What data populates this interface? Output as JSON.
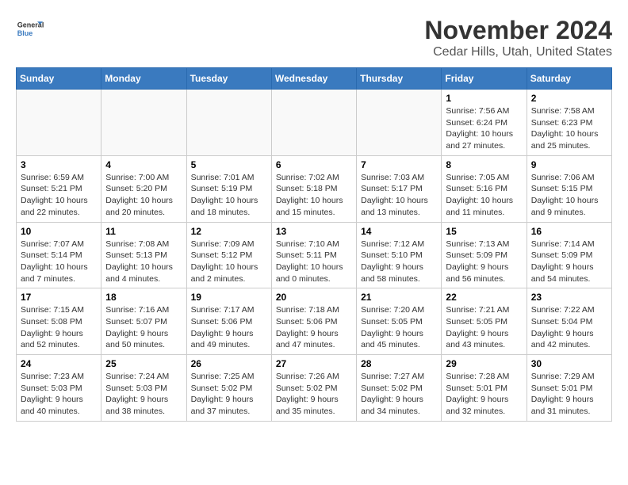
{
  "header": {
    "logo_line1": "General",
    "logo_line2": "Blue",
    "month": "November 2024",
    "location": "Cedar Hills, Utah, United States"
  },
  "weekdays": [
    "Sunday",
    "Monday",
    "Tuesday",
    "Wednesday",
    "Thursday",
    "Friday",
    "Saturday"
  ],
  "weeks": [
    [
      {
        "day": "",
        "info": ""
      },
      {
        "day": "",
        "info": ""
      },
      {
        "day": "",
        "info": ""
      },
      {
        "day": "",
        "info": ""
      },
      {
        "day": "",
        "info": ""
      },
      {
        "day": "1",
        "info": "Sunrise: 7:56 AM\nSunset: 6:24 PM\nDaylight: 10 hours and 27 minutes."
      },
      {
        "day": "2",
        "info": "Sunrise: 7:58 AM\nSunset: 6:23 PM\nDaylight: 10 hours and 25 minutes."
      }
    ],
    [
      {
        "day": "3",
        "info": "Sunrise: 6:59 AM\nSunset: 5:21 PM\nDaylight: 10 hours and 22 minutes."
      },
      {
        "day": "4",
        "info": "Sunrise: 7:00 AM\nSunset: 5:20 PM\nDaylight: 10 hours and 20 minutes."
      },
      {
        "day": "5",
        "info": "Sunrise: 7:01 AM\nSunset: 5:19 PM\nDaylight: 10 hours and 18 minutes."
      },
      {
        "day": "6",
        "info": "Sunrise: 7:02 AM\nSunset: 5:18 PM\nDaylight: 10 hours and 15 minutes."
      },
      {
        "day": "7",
        "info": "Sunrise: 7:03 AM\nSunset: 5:17 PM\nDaylight: 10 hours and 13 minutes."
      },
      {
        "day": "8",
        "info": "Sunrise: 7:05 AM\nSunset: 5:16 PM\nDaylight: 10 hours and 11 minutes."
      },
      {
        "day": "9",
        "info": "Sunrise: 7:06 AM\nSunset: 5:15 PM\nDaylight: 10 hours and 9 minutes."
      }
    ],
    [
      {
        "day": "10",
        "info": "Sunrise: 7:07 AM\nSunset: 5:14 PM\nDaylight: 10 hours and 7 minutes."
      },
      {
        "day": "11",
        "info": "Sunrise: 7:08 AM\nSunset: 5:13 PM\nDaylight: 10 hours and 4 minutes."
      },
      {
        "day": "12",
        "info": "Sunrise: 7:09 AM\nSunset: 5:12 PM\nDaylight: 10 hours and 2 minutes."
      },
      {
        "day": "13",
        "info": "Sunrise: 7:10 AM\nSunset: 5:11 PM\nDaylight: 10 hours and 0 minutes."
      },
      {
        "day": "14",
        "info": "Sunrise: 7:12 AM\nSunset: 5:10 PM\nDaylight: 9 hours and 58 minutes."
      },
      {
        "day": "15",
        "info": "Sunrise: 7:13 AM\nSunset: 5:09 PM\nDaylight: 9 hours and 56 minutes."
      },
      {
        "day": "16",
        "info": "Sunrise: 7:14 AM\nSunset: 5:09 PM\nDaylight: 9 hours and 54 minutes."
      }
    ],
    [
      {
        "day": "17",
        "info": "Sunrise: 7:15 AM\nSunset: 5:08 PM\nDaylight: 9 hours and 52 minutes."
      },
      {
        "day": "18",
        "info": "Sunrise: 7:16 AM\nSunset: 5:07 PM\nDaylight: 9 hours and 50 minutes."
      },
      {
        "day": "19",
        "info": "Sunrise: 7:17 AM\nSunset: 5:06 PM\nDaylight: 9 hours and 49 minutes."
      },
      {
        "day": "20",
        "info": "Sunrise: 7:18 AM\nSunset: 5:06 PM\nDaylight: 9 hours and 47 minutes."
      },
      {
        "day": "21",
        "info": "Sunrise: 7:20 AM\nSunset: 5:05 PM\nDaylight: 9 hours and 45 minutes."
      },
      {
        "day": "22",
        "info": "Sunrise: 7:21 AM\nSunset: 5:05 PM\nDaylight: 9 hours and 43 minutes."
      },
      {
        "day": "23",
        "info": "Sunrise: 7:22 AM\nSunset: 5:04 PM\nDaylight: 9 hours and 42 minutes."
      }
    ],
    [
      {
        "day": "24",
        "info": "Sunrise: 7:23 AM\nSunset: 5:03 PM\nDaylight: 9 hours and 40 minutes."
      },
      {
        "day": "25",
        "info": "Sunrise: 7:24 AM\nSunset: 5:03 PM\nDaylight: 9 hours and 38 minutes."
      },
      {
        "day": "26",
        "info": "Sunrise: 7:25 AM\nSunset: 5:02 PM\nDaylight: 9 hours and 37 minutes."
      },
      {
        "day": "27",
        "info": "Sunrise: 7:26 AM\nSunset: 5:02 PM\nDaylight: 9 hours and 35 minutes."
      },
      {
        "day": "28",
        "info": "Sunrise: 7:27 AM\nSunset: 5:02 PM\nDaylight: 9 hours and 34 minutes."
      },
      {
        "day": "29",
        "info": "Sunrise: 7:28 AM\nSunset: 5:01 PM\nDaylight: 9 hours and 32 minutes."
      },
      {
        "day": "30",
        "info": "Sunrise: 7:29 AM\nSunset: 5:01 PM\nDaylight: 9 hours and 31 minutes."
      }
    ]
  ]
}
